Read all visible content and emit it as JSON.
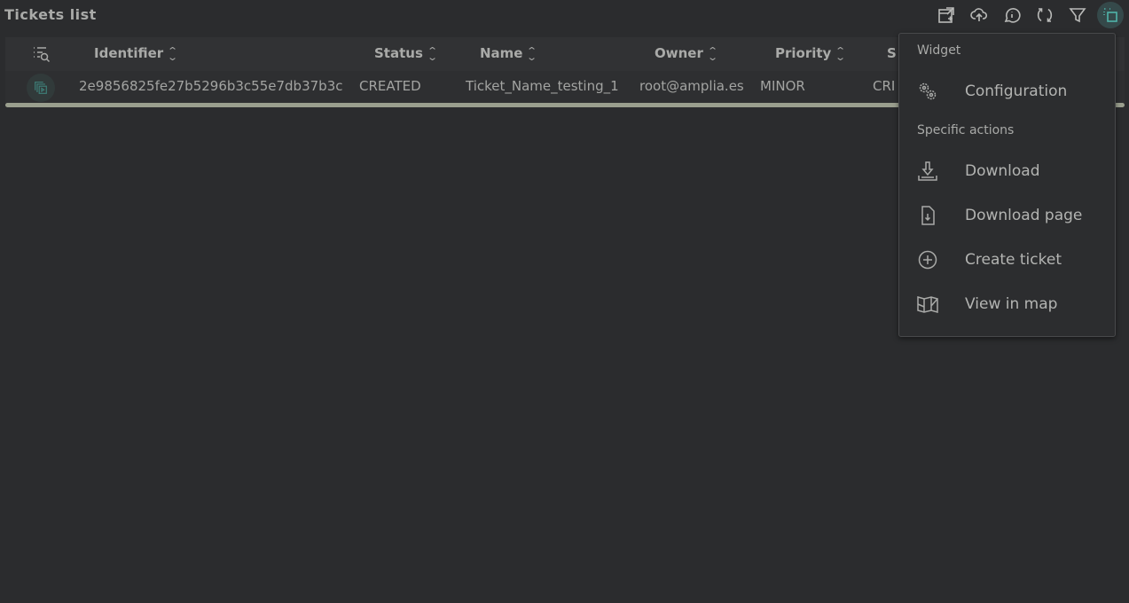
{
  "title": "Tickets list",
  "toolbar": {
    "icons": [
      "export-icon",
      "upload-icon",
      "info-icon",
      "refresh-icon",
      "filter-icon",
      "actions-icon"
    ]
  },
  "table": {
    "headers": [
      "Identifier",
      "Status",
      "Name",
      "Owner",
      "Priority",
      "S"
    ],
    "rows": [
      [
        "2e9856825fe27b5296b3c55e7db37b3c",
        "CREATED",
        "Ticket_Name_testing_1",
        "root@amplia.es",
        "MINOR",
        "CRI"
      ]
    ]
  },
  "menu": {
    "section_widget": "Widget",
    "configuration": "Configuration",
    "section_specific": "Specific actions",
    "download": "Download",
    "download_page": "Download page",
    "create_ticket": "Create ticket",
    "view_in_map": "View in map"
  },
  "colors": {
    "accent": "#4fb3a9",
    "scrollbar": "#9a9f8e",
    "background": "#2b2c2e"
  }
}
